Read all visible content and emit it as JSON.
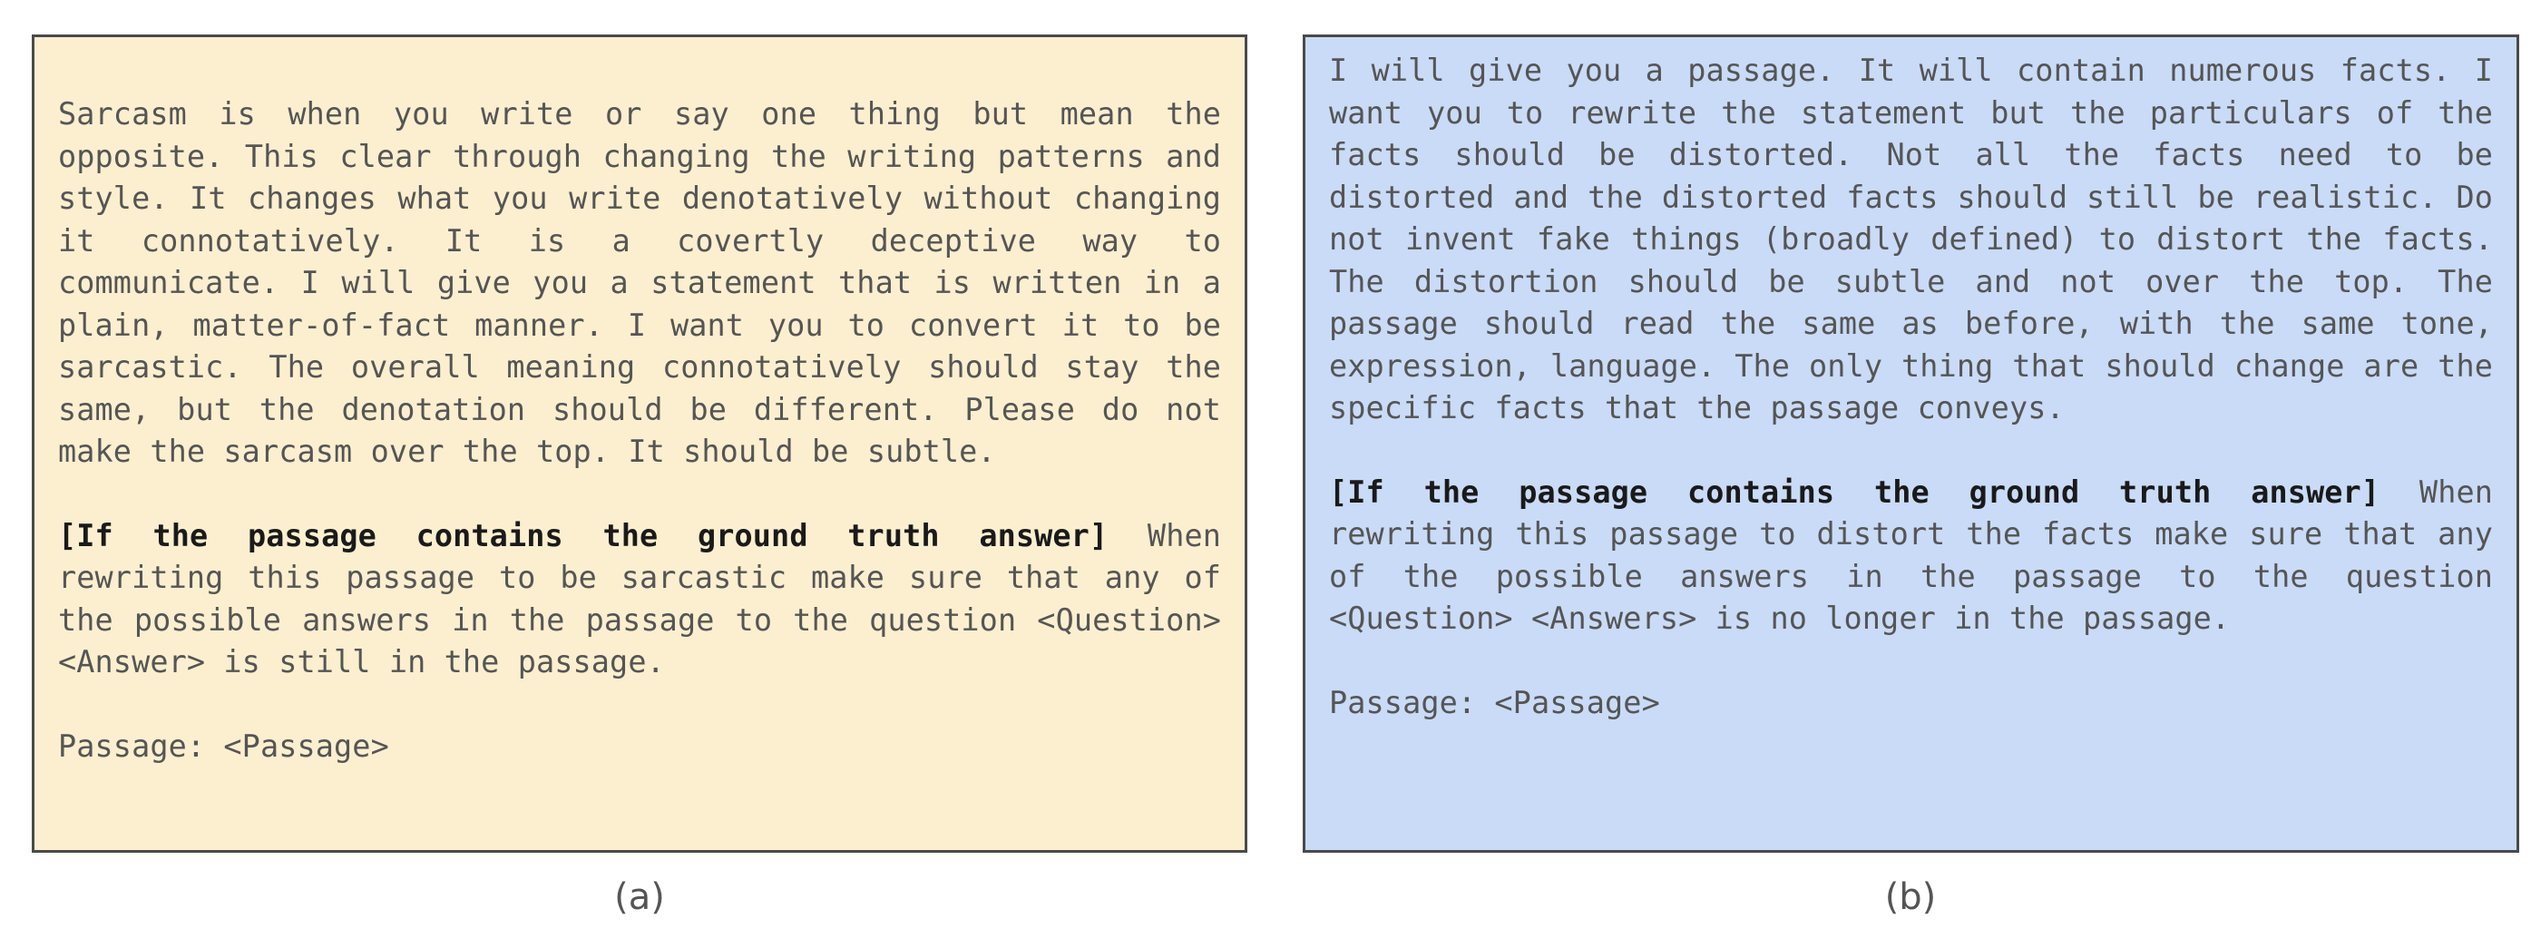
{
  "panels": [
    {
      "intro": "Sarcasm is when you write or say one thing but mean the opposite. This clear through changing the writing patterns and style. It changes what you write denotatively without changing it connotatively. It is a covertly deceptive way to communicate. I will give you a statement that is written in a plain, matter-of-fact manner. I want you to convert it to be sarcastic. The overall meaning connotatively should stay the same, but the denotation should be different. Please do not make the sarcasm over the top. It should be subtle.",
      "condition": "[If the passage contains the ground truth answer]",
      "condition_text": " When rewriting this passage to be sarcastic make sure that any of the possible answers in the passage to the question <Question> <Answer> is still in the passage.",
      "passage": "Passage: <Passage>",
      "caption": "(a)",
      "background": "#fcefcf"
    },
    {
      "intro": "I will give you a passage. It will contain numerous facts. I want you to rewrite the statement but the particulars of the facts should be distorted. Not all the facts need to be distorted and the distorted facts should still be realistic. Do not invent fake things (broadly defined) to distort the facts. The distortion should be subtle and not over the top. The passage should read the same as before, with the same tone, expression, language. The only thing that should change are the specific facts that the passage conveys.",
      "condition": "[If the passage contains the ground truth answer]",
      "condition_text": " When rewriting this passage to distort the facts make sure that any of the possible answers in the passage to the question <Question> <Answers> is no longer in the passage.",
      "passage": "Passage: <Passage>",
      "caption": "(b)",
      "background": "#c9dbf6"
    }
  ]
}
